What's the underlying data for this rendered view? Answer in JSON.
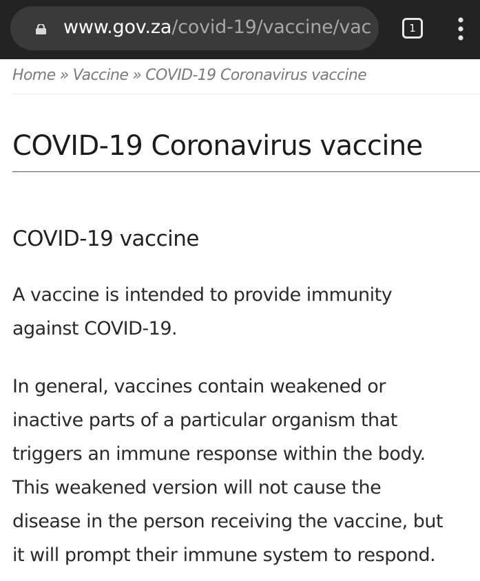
{
  "browser": {
    "url_domain": "www.gov.za",
    "url_path": "/covid-19/vaccine/vac",
    "tab_count": "1",
    "icons": {
      "lock": "lock-icon",
      "tabs": "tabs-switcher-icon",
      "menu": "overflow-menu-icon"
    },
    "colors": {
      "toolbar": "#232323",
      "urlbar": "#3a3a3a",
      "domain_text": "#ffffff",
      "path_text": "#a7a7a7"
    }
  },
  "breadcrumb": {
    "items": [
      "Home",
      "Vaccine",
      "COVID-19 Coronavirus vaccine"
    ],
    "separator": "»"
  },
  "page": {
    "title": "COVID-19 Coronavirus vaccine",
    "section_heading": "COVID-19 vaccine",
    "paragraph_1_lines": [
      "A vaccine is intended to provide immunity",
      "against COVID-19."
    ],
    "paragraph_2_lines": [
      "In general, vaccines contain weakened or",
      "inactive parts of a particular organism that",
      "triggers an immune response within the body.",
      "This weakened version will not cause the",
      "disease in the person receiving the vaccine, but",
      "it will prompt their immune system to respond."
    ]
  }
}
